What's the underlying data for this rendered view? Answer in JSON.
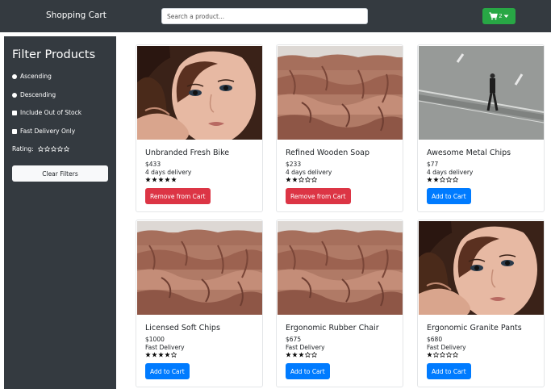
{
  "header": {
    "brand": "Shopping Cart",
    "search_placeholder": "Search a product...",
    "cart_count": "2"
  },
  "sidebar": {
    "title": "Filter Products",
    "options": [
      "Ascending",
      "Descending",
      "Include Out of Stock",
      "Fast Delivery Only"
    ],
    "rating_label": "Rating:",
    "rating_value": 0,
    "clear_label": "Clear Filters"
  },
  "products": [
    {
      "name": "Unbranded Fresh Bike",
      "price": "$433",
      "delivery": "4 days delivery",
      "rating": 5,
      "button": "Remove from Cart",
      "action": "remove",
      "image": "portrait-woman"
    },
    {
      "name": "Refined Wooden Soap",
      "price": "$233",
      "delivery": "4 days delivery",
      "rating": 2,
      "button": "Remove from Cart",
      "action": "remove",
      "image": "rocky-canyon"
    },
    {
      "name": "Awesome Metal Chips",
      "price": "$77",
      "delivery": "4 days delivery",
      "rating": 2,
      "button": "Add to Cart",
      "action": "add",
      "image": "man-crossing-road"
    },
    {
      "name": "Licensed Soft Chips",
      "price": "$1000",
      "delivery": "Fast Delivery",
      "rating": 4,
      "button": "Add to Cart",
      "action": "add",
      "image": "rocky-canyon"
    },
    {
      "name": "Ergonomic Rubber Chair",
      "price": "$675",
      "delivery": "Fast Delivery",
      "rating": 3,
      "button": "Add to Cart",
      "action": "add",
      "image": "rocky-canyon"
    },
    {
      "name": "Ergonomic Granite Pants",
      "price": "$680",
      "delivery": "Fast Delivery",
      "rating": 1,
      "button": "Add to Cart",
      "action": "add",
      "image": "portrait-woman"
    }
  ],
  "colors": {
    "navbar": "#343a40",
    "cart_button": "#28a745",
    "remove_button": "#dc3545",
    "add_button": "#007bff"
  }
}
